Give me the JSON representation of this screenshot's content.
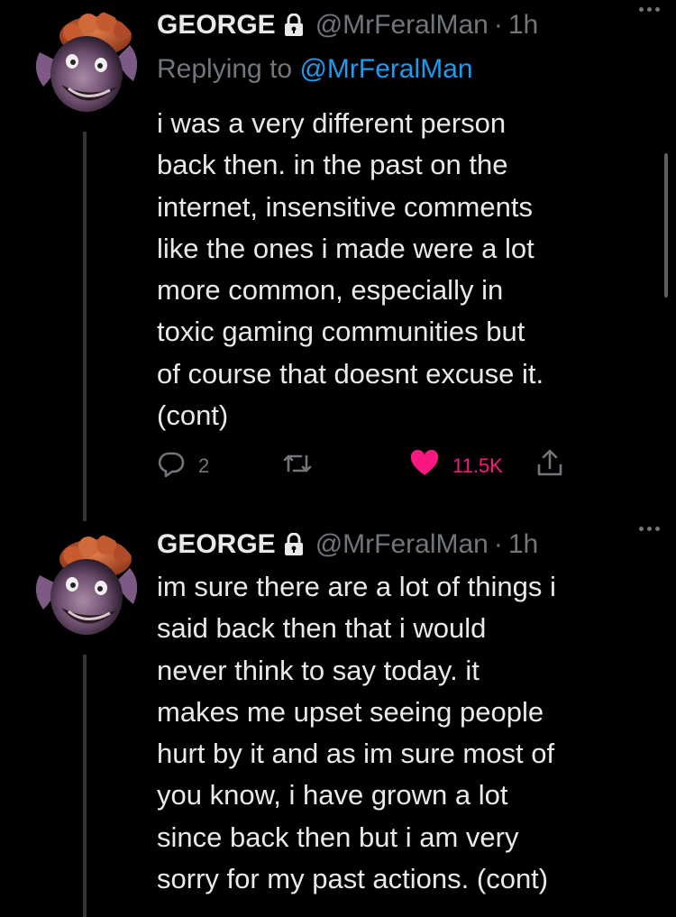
{
  "tweets": [
    {
      "name": "GEORGE",
      "handle": "@MrFeralMan",
      "separator": "·",
      "time": "1h",
      "replying_prefix": "Replying to",
      "replying_handle": "@MrFeralMan",
      "lines": [
        "i was a very different person",
        "back then. in the past on the",
        "internet, insensitive comments",
        "like the ones i made were a lot",
        "more common, especially in",
        "toxic gaming communities but",
        "of course that doesnt excuse it.",
        "(cont)"
      ],
      "reply_count": "2",
      "like_count": "11.5K"
    },
    {
      "name": "GEORGE",
      "handle": "@MrFeralMan",
      "separator": "·",
      "time": "1h",
      "lines": [
        "im sure there are a lot of things i",
        "said back then that i would",
        "never think to say today. it",
        "makes me upset seeing people",
        "hurt by it and as im sure most of",
        "you know, i have grown a lot",
        "since back then but i am very",
        "sorry for my past actions. (cont)"
      ]
    }
  ],
  "icons": {
    "lock": "lock-icon",
    "more": "more-icon",
    "reply": "reply-icon",
    "retweet": "retweet-icon",
    "like": "heart-icon",
    "share": "share-icon"
  },
  "colors": {
    "background": "#000000",
    "text": "#e7e9ea",
    "secondary": "#71767b",
    "link": "#1d9bf0",
    "like": "#f91880"
  }
}
